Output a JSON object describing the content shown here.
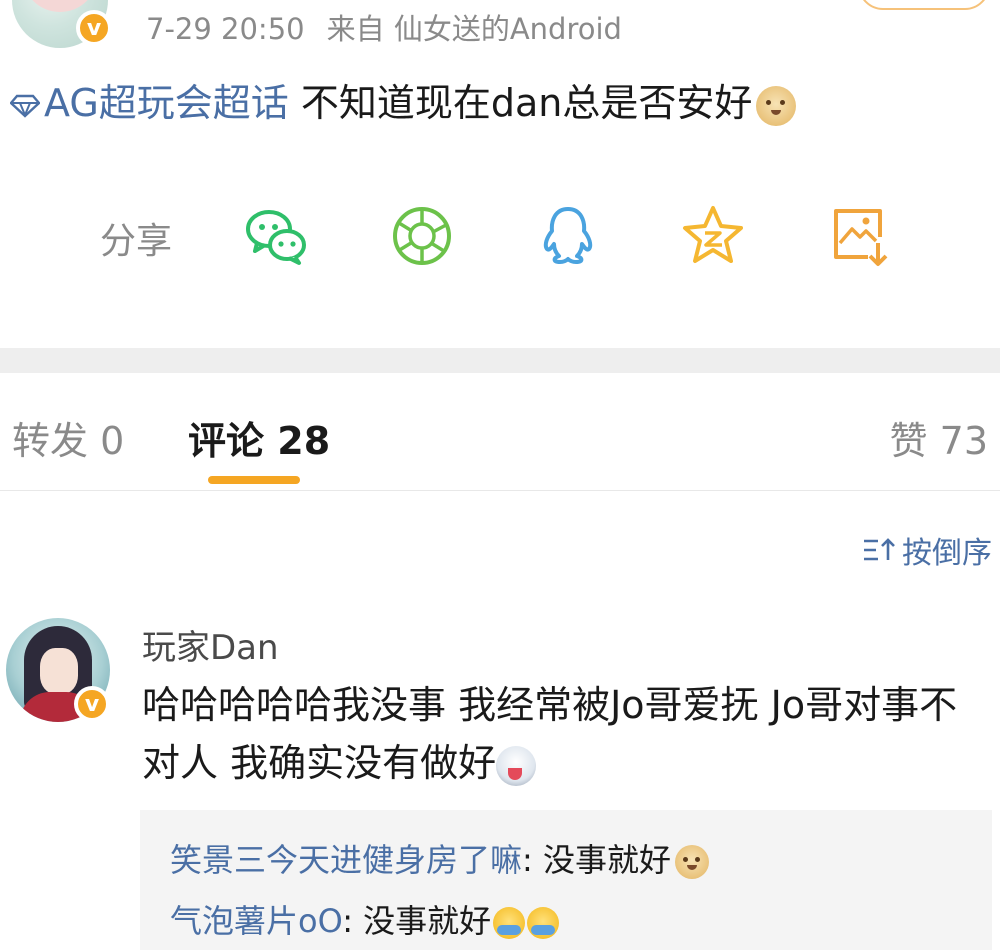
{
  "post": {
    "timestamp": "7-29 20:50",
    "source_prefix": "来自",
    "source": "仙女送的Android",
    "topic": "AG超玩会超话",
    "text": "不知道现在dan总是否安好",
    "emoji": "doge"
  },
  "share": {
    "label": "分享",
    "targets": [
      "wechat-icon",
      "moments-icon",
      "qq-icon",
      "qzone-icon",
      "save-image-icon"
    ],
    "colors": {
      "wechat": "#2fbf6a",
      "moments": "#6cc24a",
      "qq": "#4aa3df",
      "qzone": "#f5b731",
      "save": "#f0a43c"
    }
  },
  "tabs": {
    "repost_label": "转发",
    "repost_count": "0",
    "comment_label": "评论",
    "comment_count": "28",
    "like_label": "赞",
    "like_count": "73"
  },
  "sort": {
    "label": "按倒序"
  },
  "comments": [
    {
      "user": "玩家Dan",
      "verified": true,
      "text": "哈哈哈哈哈我没事 我经常被Jo哥爱抚 Jo哥对事不对人 我确实没有做好",
      "emoji": "husky",
      "replies": [
        {
          "user": "笑景三今天进健身房了嘛",
          "separator": ":",
          "text": "没事就好",
          "emoji": "doge"
        },
        {
          "user": "气泡薯片oO",
          "separator": ":",
          "text": "没事就好",
          "emoji": "hug hug"
        }
      ]
    }
  ],
  "colors": {
    "accent": "#f5a623",
    "link": "#4a6fa5",
    "muted": "#8a8a8a"
  }
}
